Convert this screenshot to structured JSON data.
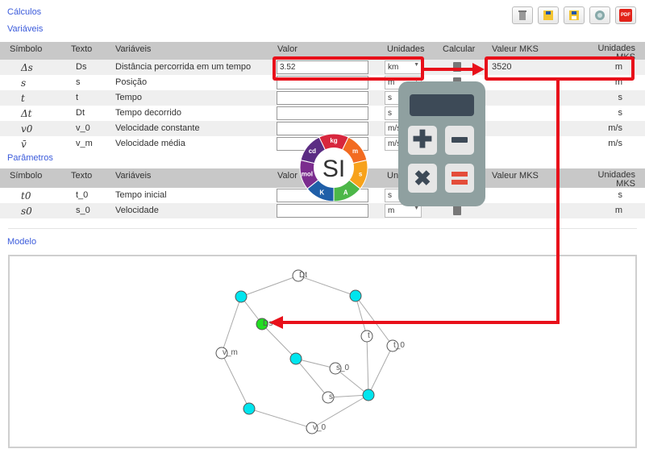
{
  "headings": {
    "calculos": "Cálculos",
    "variaveis": "Variáveis",
    "parametros": "Parâmetros",
    "modelo": "Modelo"
  },
  "toolbar": {
    "pdf_label": "PDF"
  },
  "columns": {
    "simbolo": "Símbolo",
    "texto": "Texto",
    "variaveis": "Variáveis",
    "valor": "Valor",
    "unidades": "Unidades",
    "calcular": "Calcular",
    "valeur_mks": "Valeur MKS",
    "unidades_mks": "Unidades MKS"
  },
  "variables": [
    {
      "symbol": "Δs",
      "text": "Ds",
      "name": "Distância percorrida em um tempo",
      "value": "3.52",
      "unit": "km",
      "mks_value": "3520",
      "mks_unit": "m"
    },
    {
      "symbol": "s",
      "text": "s",
      "name": "Posição",
      "value": "",
      "unit": "m",
      "mks_value": "",
      "mks_unit": "m"
    },
    {
      "symbol": "t",
      "text": "t",
      "name": "Tempo",
      "value": "",
      "unit": "s",
      "mks_value": "",
      "mks_unit": "s"
    },
    {
      "symbol": "Δt",
      "text": "Dt",
      "name": "Tempo decorrido",
      "value": "",
      "unit": "s",
      "mks_value": "",
      "mks_unit": "s"
    },
    {
      "symbol": "v0",
      "text": "v_0",
      "name": "Velocidade constante",
      "value": "",
      "unit": "m/s",
      "mks_value": "",
      "mks_unit": "m/s"
    },
    {
      "symbol": "v̄",
      "text": "v_m",
      "name": "Velocidade média",
      "value": "",
      "unit": "m/s",
      "mks_value": "",
      "mks_unit": "m/s"
    }
  ],
  "parameters": [
    {
      "symbol": "t0",
      "text": "t_0",
      "name": "Tempo inicial",
      "value": "",
      "unit": "s",
      "mks_unit": "s"
    },
    {
      "symbol": "s0",
      "text": "s_0",
      "name": "Velocidade",
      "value": "",
      "unit": "m",
      "mks_unit": "m"
    }
  ],
  "si_logo": {
    "center": "SI",
    "units": [
      "kg",
      "m",
      "s",
      "A",
      "K",
      "mol",
      "cd"
    ]
  },
  "graph": {
    "nodes": [
      {
        "label": "Dt",
        "color": "#ffffff"
      },
      {
        "label": "",
        "color": "#00e5ee"
      },
      {
        "label": "",
        "color": "#00e5ee"
      },
      {
        "label": "Ds",
        "color": "#22dd22"
      },
      {
        "label": "v_m",
        "color": "#ffffff"
      },
      {
        "label": "t",
        "color": "#ffffff"
      },
      {
        "label": "t_0",
        "color": "#ffffff"
      },
      {
        "label": "",
        "color": "#00e5ee"
      },
      {
        "label": "s_0",
        "color": "#ffffff"
      },
      {
        "label": "s",
        "color": "#ffffff"
      },
      {
        "label": "",
        "color": "#00e5ee"
      },
      {
        "label": "",
        "color": "#00e5ee"
      },
      {
        "label": "v_0",
        "color": "#ffffff"
      }
    ],
    "edges": [
      [
        0,
        1
      ],
      [
        0,
        2
      ],
      [
        1,
        3
      ],
      [
        1,
        4
      ],
      [
        2,
        5
      ],
      [
        2,
        6
      ],
      [
        3,
        7
      ],
      [
        7,
        8
      ],
      [
        7,
        9
      ],
      [
        8,
        10
      ],
      [
        9,
        10
      ],
      [
        5,
        10
      ],
      [
        6,
        10
      ],
      [
        4,
        11
      ],
      [
        11,
        12
      ],
      [
        12,
        10
      ]
    ]
  }
}
